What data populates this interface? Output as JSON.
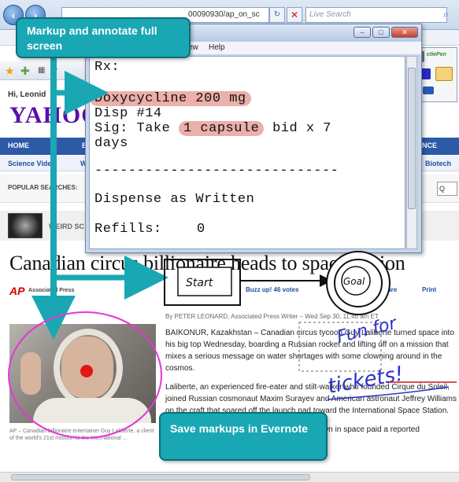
{
  "browser": {
    "url_visible": "00090930/ap_on_sc",
    "search_placeholder": "Live Search",
    "back_icon": "back-arrow-icon",
    "forward_icon": "forward-arrow-icon"
  },
  "rx_window": {
    "menu_help": "Help",
    "menu_view": "ew",
    "rx_label": "Rx:",
    "drug": "Doxycycline 200 mg",
    "disp": "Disp #14",
    "sig_prefix": "Sig: Take",
    "sig_highlight": "1 capsule",
    "sig_suffix": "bid x 7",
    "sig_line2": "days",
    "divider": "-----------------------------",
    "dispense": "Dispense as Written",
    "refills_label": "Refills:",
    "refills_value": "0"
  },
  "pen_toolbar": {
    "brand": "ctiePen"
  },
  "yahoo": {
    "greeting": "Hi, Leonid",
    "logo": "YAHOO",
    "nav_home": "HOME",
    "nav_u": "U",
    "nav_b": "B",
    "nav_nce": "NCE",
    "sub_science_video": "Science Video",
    "sub_w": "W",
    "sub_biotech": "Biotech",
    "popular_searches": "POPULAR SEARCHES:",
    "popular_q": "Q",
    "weird_label": "WEIRD SC",
    "headline": "Canadian circus billionaire heads to space station",
    "ap_logo": "AP",
    "ap_sub": "Associated Press",
    "buzz": "Buzz up! 46 votes",
    "share": "Share",
    "print": "Print",
    "byline": "By PETER LEONARD, Associated Press Writer – Wed Sep 30, 11:45 am ET",
    "para1": "BAIKONUR, Kazakhstan – Canadian circus tycoon Guy Laliberte turned space into his big top Wednesday, boarding a Russian rocket and lifting off on a mission that mixes a serious message on water shortages with some clowning around in the cosmos.",
    "para2": "Laliberte, an experienced fire-eater and stilt-walker who founded Cirque du Soleil, joined Russian cosmonaut Maxim Surayev and American astronaut Jeffrey Williams on the craft that soared off the launch pad toward the International Space Station.",
    "para3": "The 50-year-old who calls himself the first clown in space paid a reported",
    "caption": "AP – Canadian billionaire entertainer Guy Laliberte, a client of the world's 21st mission to the International ..."
  },
  "callouts": {
    "top": "Markup and annotate full screen",
    "bottom": "Save markups in Evernote"
  },
  "annotations": {
    "start": "Start",
    "goal": "Goal",
    "fun": "Fun for",
    "tickets": "tickets!"
  }
}
